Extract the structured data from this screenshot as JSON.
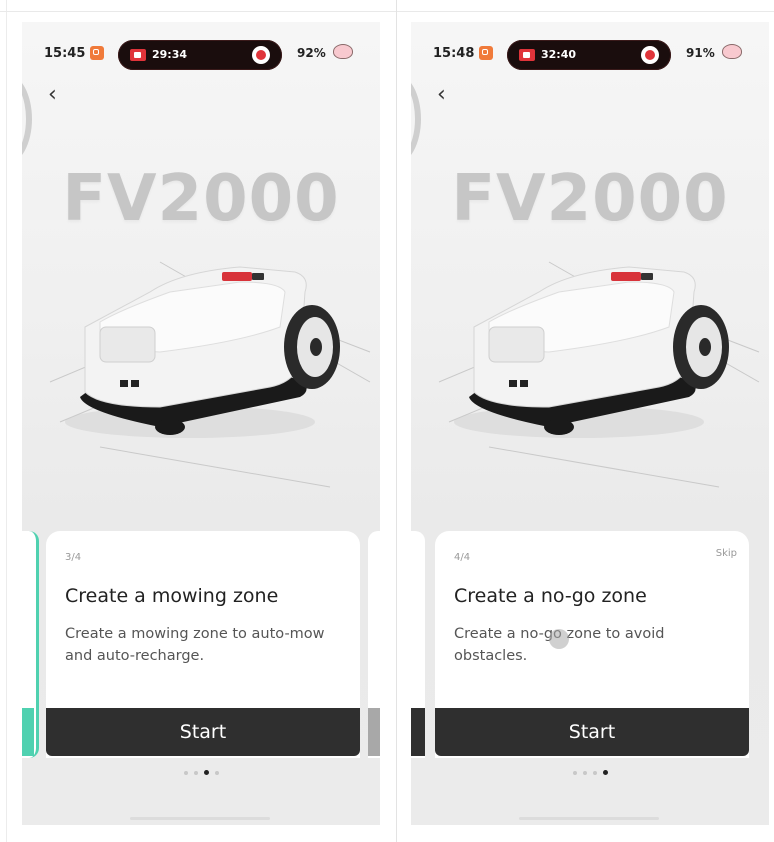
{
  "screens": [
    {
      "status": {
        "time": "15:45",
        "recording_time": "29:34",
        "battery": "92%"
      },
      "hero_title": "FV2000",
      "card": {
        "step": "3/4",
        "skip": "",
        "title": "Create a mowing zone",
        "description": "Create a mowing zone to auto-mow and auto-recharge.",
        "button": "Start"
      },
      "pagination": {
        "total": 4,
        "active": 3
      },
      "accent_left": "#4fd1b0",
      "accent_right": "#a8a8a8"
    },
    {
      "status": {
        "time": "15:48",
        "recording_time": "32:40",
        "battery": "91%"
      },
      "hero_title": "FV2000",
      "card": {
        "step": "4/4",
        "skip": "Skip",
        "title": "Create a no-go zone",
        "description": "Create a no-go zone to avoid obstacles.",
        "button": "Start"
      },
      "pagination": {
        "total": 4,
        "active": 4
      },
      "accent_left": "#2f2f2f",
      "accent_right": ""
    }
  ],
  "icons": {
    "back": "chevron-left-icon",
    "record": "screen-record-icon",
    "notification": "notification-icon",
    "status_extra": "brain-icon"
  },
  "colors": {
    "button_bg": "#2f2f2f",
    "record_red": "#e0343a",
    "teal_accent": "#4fd1b0"
  }
}
